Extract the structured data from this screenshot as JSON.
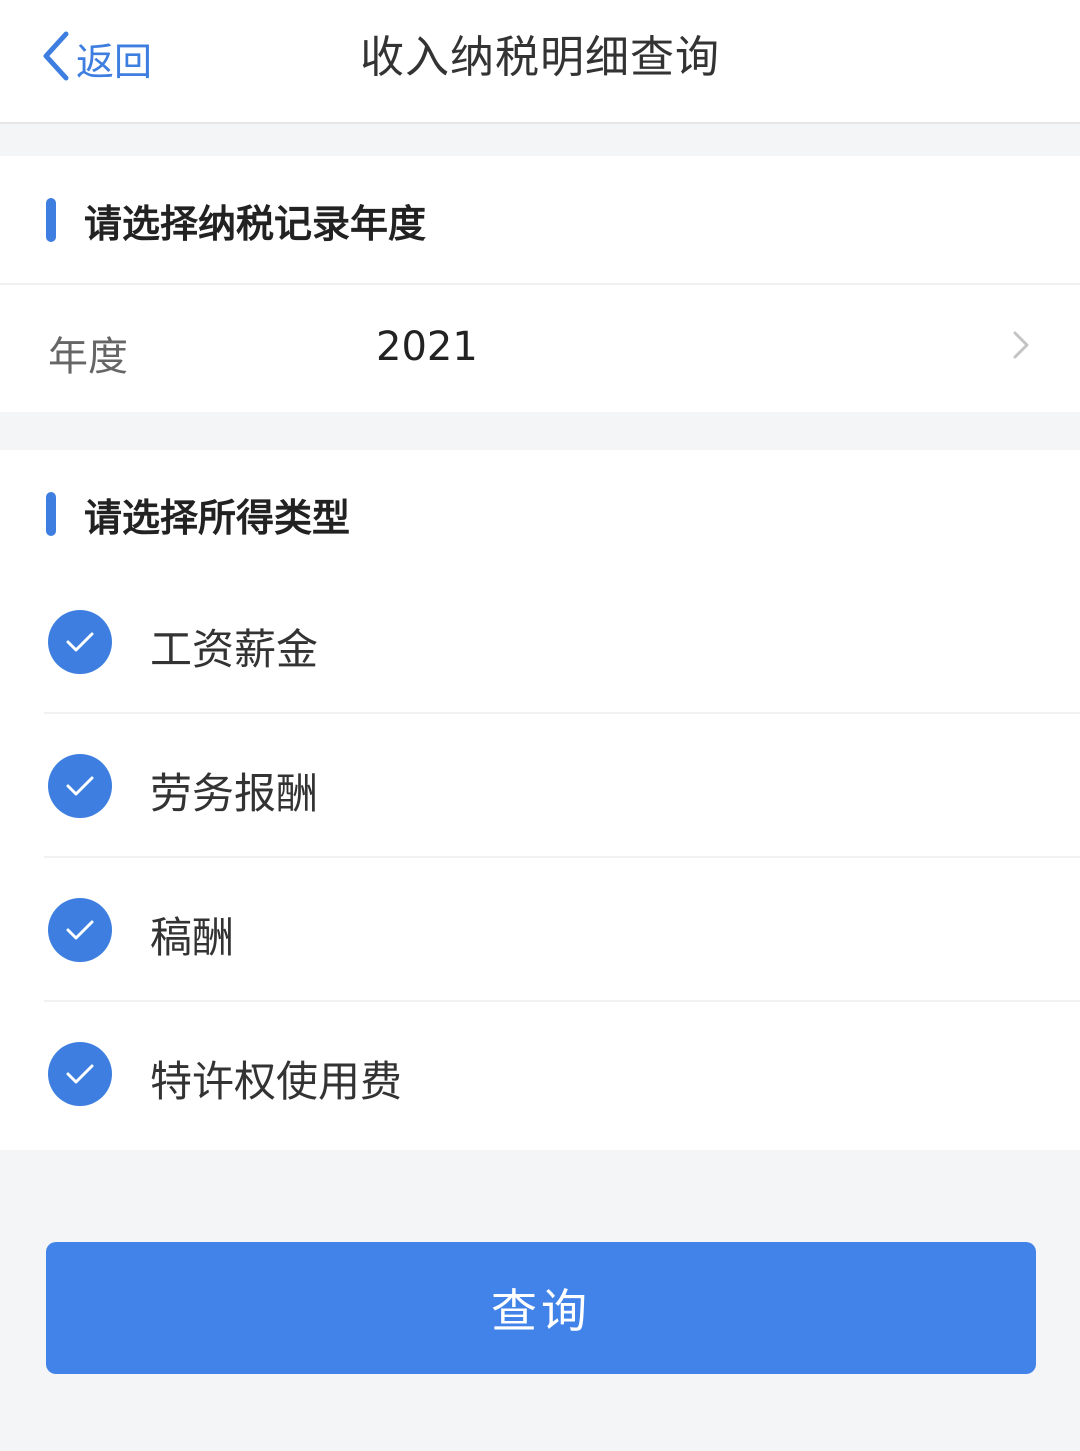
{
  "header": {
    "back_label": "返回",
    "title": "收入纳税明细查询"
  },
  "year_section": {
    "title": "请选择纳税记录年度",
    "field_label": "年度",
    "field_value": "2021"
  },
  "type_section": {
    "title": "请选择所得类型",
    "options": [
      {
        "label": "工资薪金",
        "checked": true
      },
      {
        "label": "劳务报酬",
        "checked": true
      },
      {
        "label": "稿酬",
        "checked": true
      },
      {
        "label": "特许权使用费",
        "checked": true
      }
    ]
  },
  "query_button": {
    "label": "查询"
  },
  "colors": {
    "accent": "#3d7ee0",
    "button": "#4283ea",
    "background": "#f4f5f7"
  }
}
